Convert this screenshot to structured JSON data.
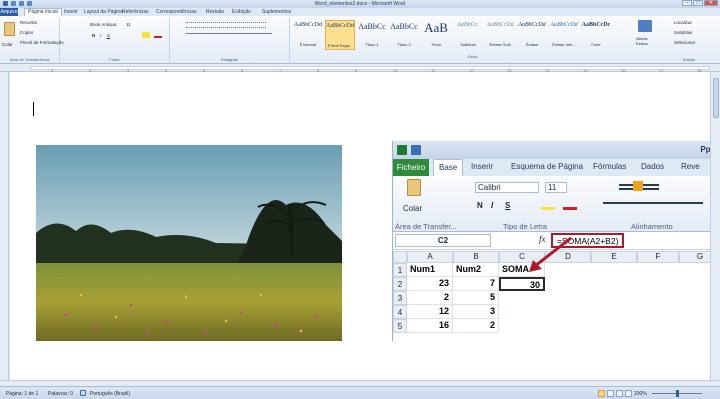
{
  "window": {
    "title": "Word_elementos2.docx - Microsoft Word",
    "minimize": "–",
    "maximize": "□",
    "close": "✕"
  },
  "tabs": [
    "Arquivo",
    "Página Inicial",
    "Inserir",
    "Layout da Página",
    "Referências",
    "Correspondências",
    "Revisão",
    "Exibição",
    "Suplementos"
  ],
  "ribbon": {
    "clipboard": {
      "paste": "Colar",
      "cut": "Recortar",
      "copy": "Copiar",
      "format_painter": "Pincel de Formatação",
      "label": "Área de Transferência"
    },
    "font": {
      "family": "Book Antiqua",
      "size": "11",
      "bold": "N",
      "italic": "I",
      "underline": "S",
      "label": "Fonte"
    },
    "paragraph": {
      "label": "Parágrafo"
    },
    "styles": {
      "label": "Estilo",
      "items": [
        {
          "sample": "AaBbCcDd",
          "name": "¶ Normal"
        },
        {
          "sample": "AaBbCcDd",
          "name": "¶ Sem Espa..."
        },
        {
          "sample": "AaBbCc",
          "name": "Título 1"
        },
        {
          "sample": "AaBbCc",
          "name": "Título 2"
        },
        {
          "sample": "AaB",
          "name": "Título"
        },
        {
          "sample": "AaBbCc.",
          "name": "Subtítulo"
        },
        {
          "sample": "AaBbCcDd",
          "name": "Ênfase Sutil"
        },
        {
          "sample": "AaBbCcDd",
          "name": "Ênfase"
        },
        {
          "sample": "AaBbCcDd",
          "name": "Ênfase Inte..."
        },
        {
          "sample": "AaBbCcDc",
          "name": "Forte"
        }
      ],
      "change": "Alterar Estilos"
    },
    "editing": {
      "find": "Localizar",
      "replace": "Substituir",
      "select": "Selecionar",
      "label": "Edição"
    }
  },
  "ruler_numbers": [
    "1",
    "2",
    "3",
    "4",
    "5",
    "6",
    "7",
    "8",
    "9",
    "10",
    "11",
    "12",
    "13",
    "14",
    "15",
    "16",
    "17",
    "18"
  ],
  "status": {
    "page": "Página: 1 de 1",
    "words": "Palavras: 0",
    "language": "Português (Brasil)",
    "zoom": "200%"
  },
  "excel": {
    "title_right": "Pplw",
    "tabs": [
      "Ficheiro",
      "Base",
      "Inserir",
      "Esquema de Página",
      "Fórmulas",
      "Dados",
      "Reve"
    ],
    "paste": "Colar",
    "font": "Calibri",
    "size": "11",
    "bold": "N",
    "italic": "I",
    "underline": "S",
    "group_clipboard": "Área de Transfer...",
    "group_font": "Tipo de Letra",
    "group_align": "Alinhamento",
    "namebox": "C2",
    "fx": "fx",
    "formula": "=SOMA(A2+B2)",
    "columns": [
      "A",
      "B",
      "C",
      "D",
      "E",
      "F",
      "G"
    ],
    "rows": [
      {
        "n": "1",
        "a": "Num1",
        "b": "Num2",
        "c": "SOMA"
      },
      {
        "n": "2",
        "a": "23",
        "b": "7",
        "c": "30"
      },
      {
        "n": "3",
        "a": "2",
        "b": "5",
        "c": ""
      },
      {
        "n": "4",
        "a": "12",
        "b": "3",
        "c": ""
      },
      {
        "n": "5",
        "a": "16",
        "b": "2",
        "c": ""
      }
    ]
  }
}
